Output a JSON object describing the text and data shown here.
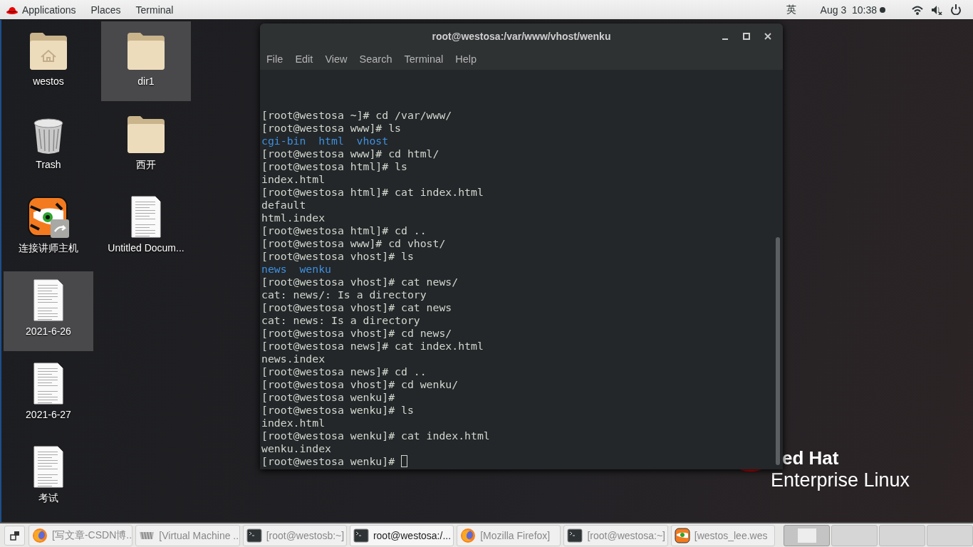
{
  "top_bar": {
    "menus": [
      "Applications",
      "Places",
      "Terminal"
    ],
    "input_method": "英",
    "clock": "Aug 3  10:38",
    "notification_dot": true
  },
  "desktop_icons": [
    {
      "label": "westos",
      "kind": "home-folder",
      "selected": false
    },
    {
      "label": "Trash",
      "kind": "trash",
      "selected": false
    },
    {
      "label": "连接讲师主机",
      "kind": "launcher",
      "selected": false
    },
    {
      "label": "2021-6-26",
      "kind": "document",
      "selected": true
    },
    {
      "label": "2021-6-27",
      "kind": "document",
      "selected": false
    },
    {
      "label": "考试",
      "kind": "document",
      "selected": false
    },
    {
      "label": "dir1",
      "kind": "folder",
      "selected": true
    },
    {
      "label": "西开",
      "kind": "folder",
      "selected": false
    },
    {
      "label": "Untitled Docum...",
      "kind": "document",
      "selected": false
    }
  ],
  "wallpaper": {
    "logo_line_1": "ed Hat",
    "logo_line_2": "Enterprise Linux"
  },
  "terminal": {
    "title": "root@westosa:/var/www/vhost/wenku",
    "menus": [
      "File",
      "Edit",
      "View",
      "Search",
      "Terminal",
      "Help"
    ],
    "lines": [
      {
        "kind": "text",
        "text": "[root@westosa ~]# cd /var/www/"
      },
      {
        "kind": "text",
        "text": "[root@westosa www]# ls"
      },
      {
        "kind": "dirs",
        "items": [
          "cgi-bin",
          "html",
          "vhost"
        ]
      },
      {
        "kind": "text",
        "text": "[root@westosa www]# cd html/"
      },
      {
        "kind": "text",
        "text": "[root@westosa html]# ls"
      },
      {
        "kind": "text",
        "text": "index.html"
      },
      {
        "kind": "text",
        "text": "[root@westosa html]# cat index.html"
      },
      {
        "kind": "text",
        "text": "default"
      },
      {
        "kind": "text",
        "text": "html.index"
      },
      {
        "kind": "text",
        "text": "[root@westosa html]# cd .."
      },
      {
        "kind": "text",
        "text": "[root@westosa www]# cd vhost/"
      },
      {
        "kind": "text",
        "text": "[root@westosa vhost]# ls"
      },
      {
        "kind": "dirs",
        "items": [
          "news",
          "wenku"
        ]
      },
      {
        "kind": "text",
        "text": "[root@westosa vhost]# cat news/"
      },
      {
        "kind": "text",
        "text": "cat: news/: Is a directory"
      },
      {
        "kind": "text",
        "text": "[root@westosa vhost]# cat news"
      },
      {
        "kind": "text",
        "text": "cat: news: Is a directory"
      },
      {
        "kind": "text",
        "text": "[root@westosa vhost]# cd news/"
      },
      {
        "kind": "text",
        "text": "[root@westosa news]# cat index.html"
      },
      {
        "kind": "text",
        "text": "news.index"
      },
      {
        "kind": "text",
        "text": "[root@westosa news]# cd .."
      },
      {
        "kind": "text",
        "text": "[root@westosa vhost]# cd wenku/"
      },
      {
        "kind": "text",
        "text": "[root@westosa wenku]#"
      },
      {
        "kind": "text",
        "text": "[root@westosa wenku]# ls"
      },
      {
        "kind": "text",
        "text": "index.html"
      },
      {
        "kind": "text",
        "text": "[root@westosa wenku]# cat index.html"
      },
      {
        "kind": "text",
        "text": "wenku.index"
      },
      {
        "kind": "prompt",
        "text": "[root@westosa wenku]# ",
        "cursor": true
      }
    ]
  },
  "taskbar": {
    "items": [
      {
        "label": "[写文章-CSDN博...",
        "kind": "browser",
        "selected": false
      },
      {
        "label": "[Virtual Machine ...",
        "kind": "vm",
        "selected": false
      },
      {
        "label": "[root@westosb:~]",
        "kind": "terminal",
        "selected": false
      },
      {
        "label": "root@westosa:/...",
        "kind": "terminal",
        "selected": true
      },
      {
        "label": "[Mozilla Firefox]",
        "kind": "browser",
        "selected": false
      },
      {
        "label": "[root@westosa:~]",
        "kind": "terminal",
        "selected": false
      },
      {
        "label": "[westos_lee.wes",
        "kind": "launcher",
        "selected": false
      }
    ],
    "workspaces": [
      {
        "selected": true
      },
      {
        "selected": false
      },
      {
        "selected": false
      },
      {
        "selected": false
      }
    ]
  }
}
